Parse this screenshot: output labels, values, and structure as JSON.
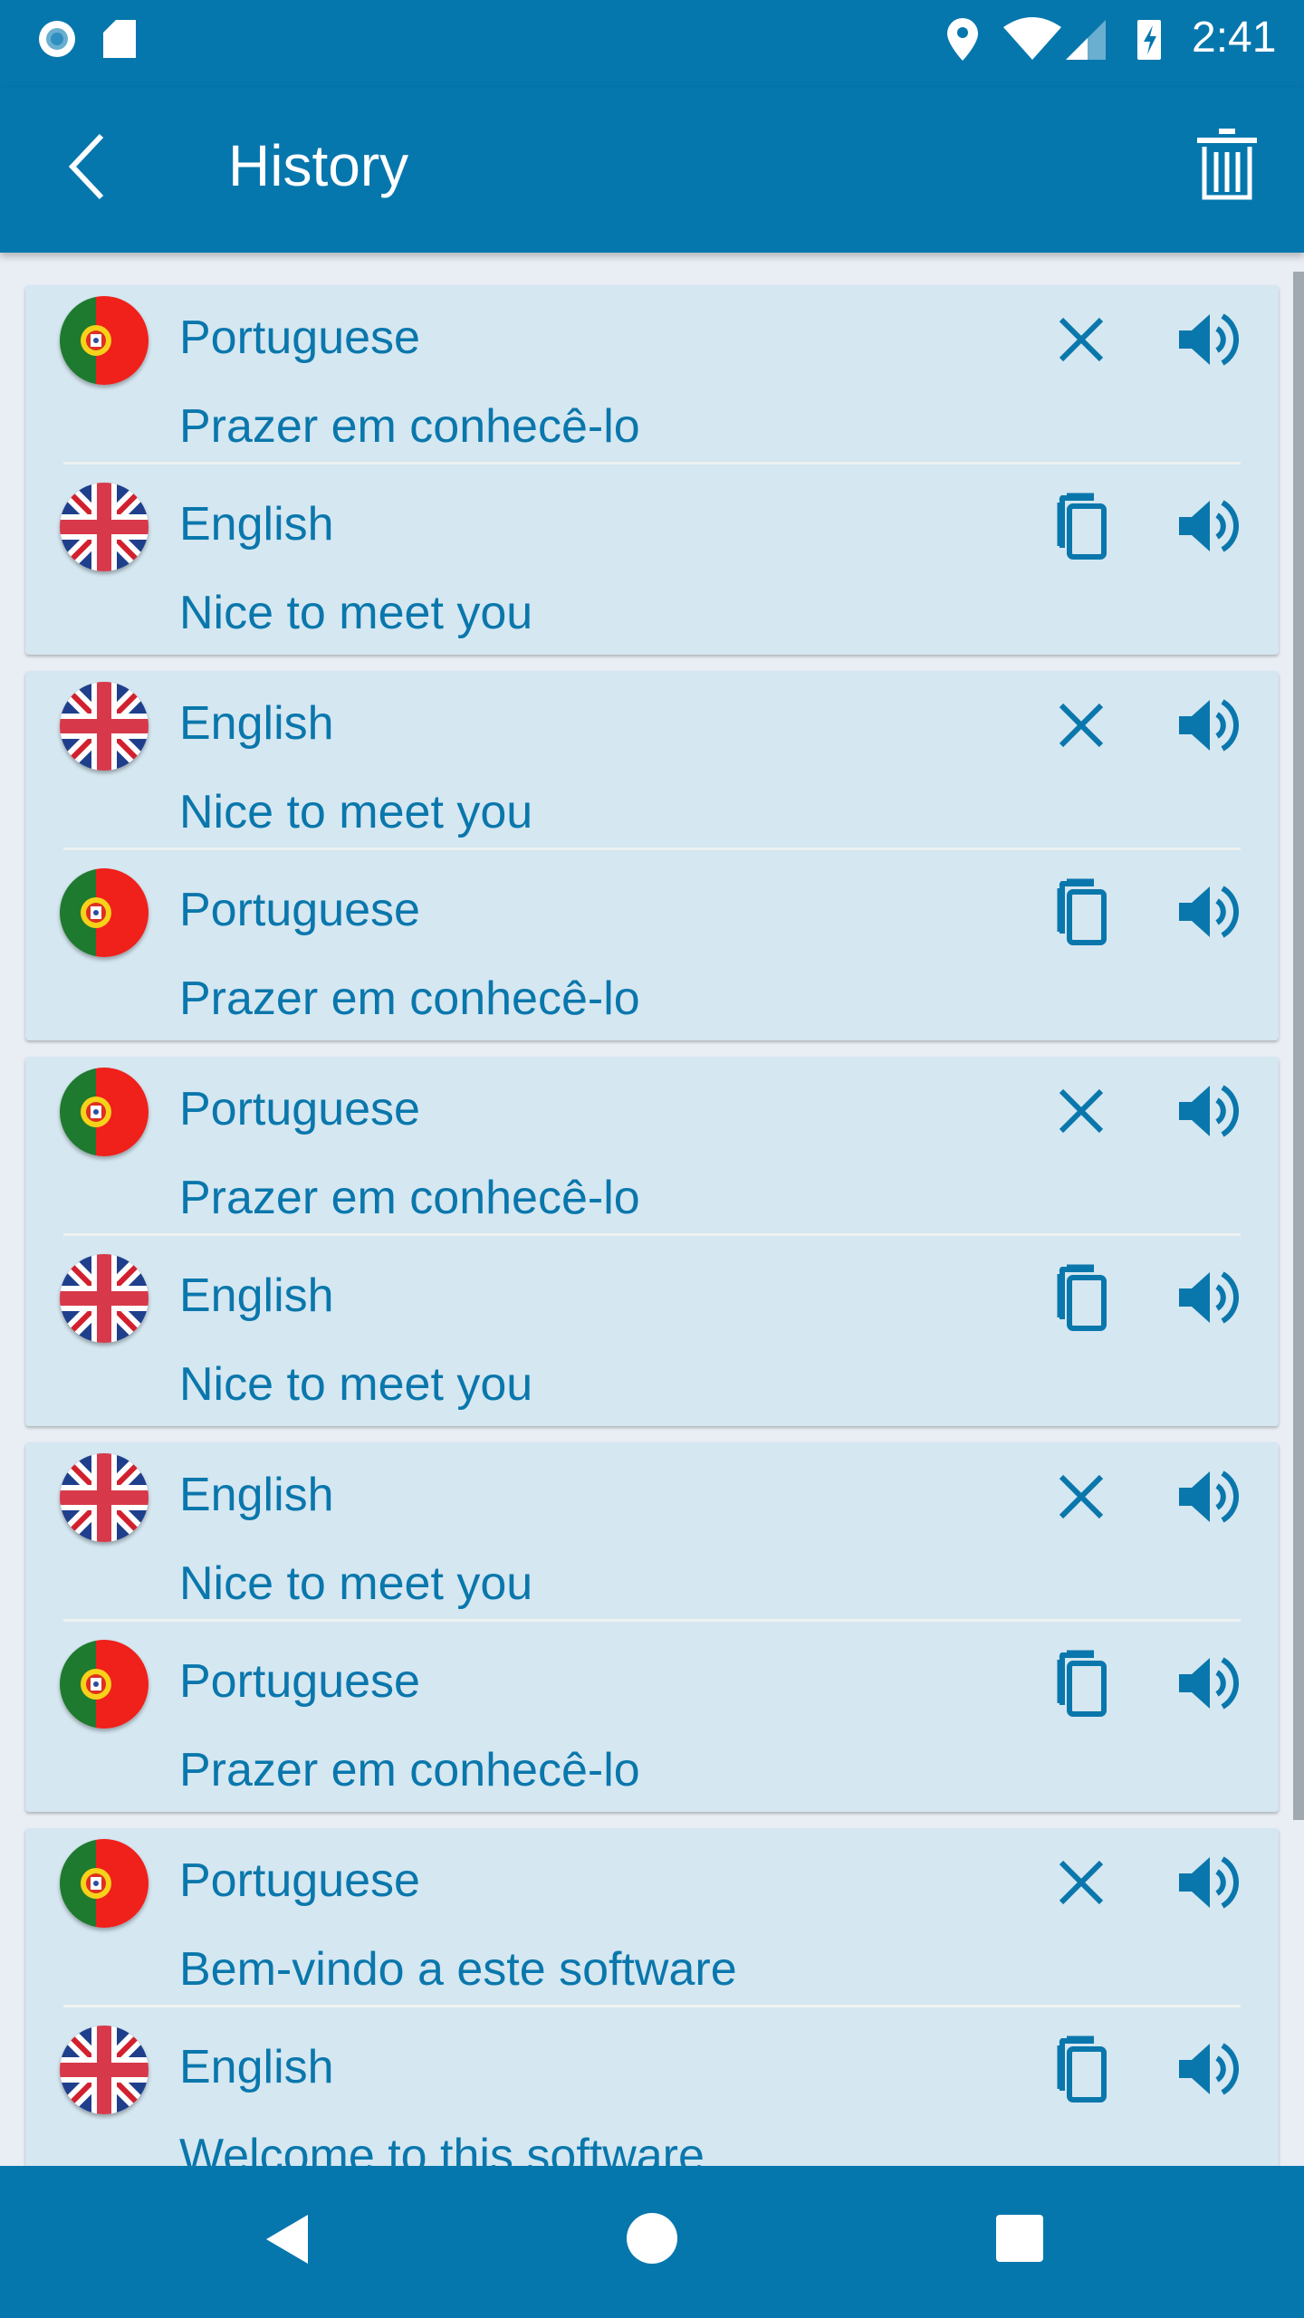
{
  "status_bar": {
    "time": "2:41",
    "icons": [
      "circle-icon",
      "sd-card-icon",
      "location-icon",
      "wifi-icon",
      "signal-icon",
      "battery-charging-icon"
    ]
  },
  "app_bar": {
    "title": "History",
    "back_icon": "back-arrow-icon",
    "delete_icon": "trash-icon"
  },
  "colors": {
    "primary": "#0677AD",
    "card": "#D5E7F1",
    "text": "#0A77AC",
    "background": "#E9EEF5"
  },
  "history": [
    {
      "source": {
        "language": "Portuguese",
        "text": "Prazer em conhecê-lo",
        "flag": "pt"
      },
      "target": {
        "language": "English",
        "text": "Nice to meet you",
        "flag": "gb"
      }
    },
    {
      "source": {
        "language": "English",
        "text": "Nice to meet you",
        "flag": "gb"
      },
      "target": {
        "language": "Portuguese",
        "text": "Prazer em conhecê-lo",
        "flag": "pt"
      }
    },
    {
      "source": {
        "language": "Portuguese",
        "text": "Prazer em conhecê-lo",
        "flag": "pt"
      },
      "target": {
        "language": "English",
        "text": "Nice to meet you",
        "flag": "gb"
      }
    },
    {
      "source": {
        "language": "English",
        "text": "Nice to meet you",
        "flag": "gb"
      },
      "target": {
        "language": "Portuguese",
        "text": "Prazer em conhecê-lo",
        "flag": "pt"
      }
    },
    {
      "source": {
        "language": "Portuguese",
        "text": "Bem-vindo a este software",
        "flag": "pt"
      },
      "target": {
        "language": "English",
        "text": "Welcome to this software",
        "flag": "gb"
      }
    }
  ]
}
